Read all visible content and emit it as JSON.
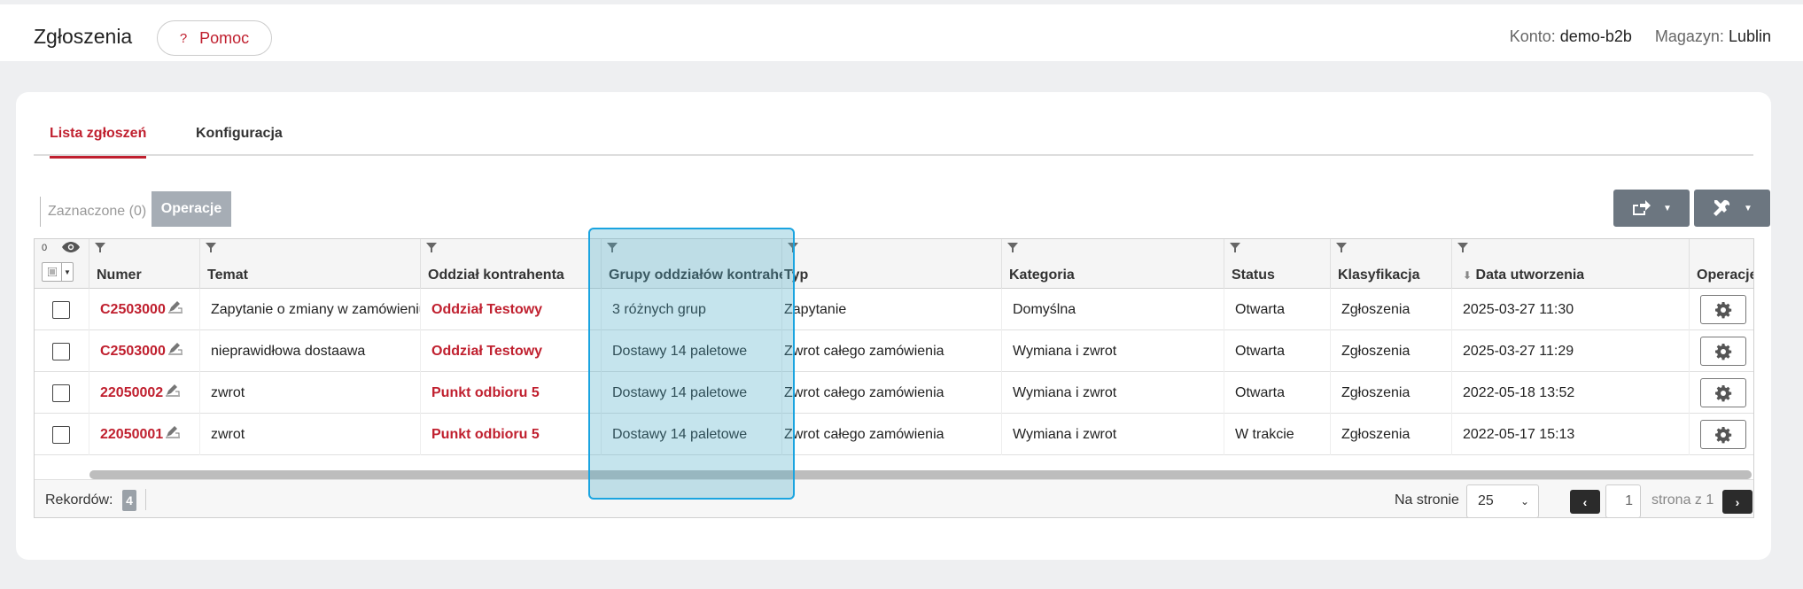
{
  "header": {
    "title": "Zgłoszenia",
    "help_label": "Pomoc",
    "help_icon": "?",
    "account_label": "Konto:",
    "account_value": "demo-b2b",
    "warehouse_label": "Magazyn:",
    "warehouse_value": "Lublin"
  },
  "tabs": [
    {
      "label": "Lista zgłoszeń",
      "active": true
    },
    {
      "label": "Konfiguracja",
      "active": false
    }
  ],
  "toolbar": {
    "selected_label": "Zaznaczone (0)",
    "operations_label": "Operacje",
    "export_icon": "export-icon",
    "tools_icon": "tools-icon"
  },
  "table": {
    "visible_columns_count": "0",
    "columns": [
      "Numer",
      "Temat",
      "Oddział kontrahenta",
      "Grupy oddziałów kontrahenta",
      "Typ",
      "Kategoria",
      "Status",
      "Klasyfikacja",
      "Data utworzenia",
      "Operacje"
    ],
    "rows": [
      {
        "numer": "C2503000",
        "temat": "Zapytanie o zmiany w zamówieniu",
        "oddzial": "Oddział Testowy",
        "grupy": "3 różnych grup",
        "typ": "Zapytanie",
        "kategoria": "Domyślna",
        "status": "Otwarta",
        "klasyfikacja": "Zgłoszenia",
        "data": "2025-03-27 11:30"
      },
      {
        "numer": "C2503000",
        "temat": "nieprawidłowa dostaawa",
        "oddzial": "Oddział Testowy",
        "grupy": "Dostawy 14 paletowe",
        "typ": "Zwrot całego zamówienia",
        "kategoria": "Wymiana i zwrot",
        "status": "Otwarta",
        "klasyfikacja": "Zgłoszenia",
        "data": "2025-03-27 11:29"
      },
      {
        "numer": "22050002",
        "temat": "zwrot",
        "oddzial": "Punkt odbioru 5",
        "grupy": "Dostawy 14 paletowe",
        "typ": "Zwrot całego zamówienia",
        "kategoria": "Wymiana i zwrot",
        "status": "Otwarta",
        "klasyfikacja": "Zgłoszenia",
        "data": "2022-05-18 13:52"
      },
      {
        "numer": "22050001",
        "temat": "zwrot",
        "oddzial": "Punkt odbioru 5",
        "grupy": "Dostawy 14 paletowe",
        "typ": "Zwrot całego zamówienia",
        "kategoria": "Wymiana i zwrot",
        "status": "W trakcie",
        "klasyfikacja": "Zgłoszenia",
        "data": "2022-05-17 15:13"
      }
    ]
  },
  "footer": {
    "records_label": "Rekordów:",
    "records_count": "4",
    "per_page_label": "Na stronie",
    "per_page_value": "25",
    "page_value": "1",
    "page_of": "strona z 1"
  },
  "colors": {
    "accent": "#c0202f",
    "highlight": "#1aa4e0"
  }
}
